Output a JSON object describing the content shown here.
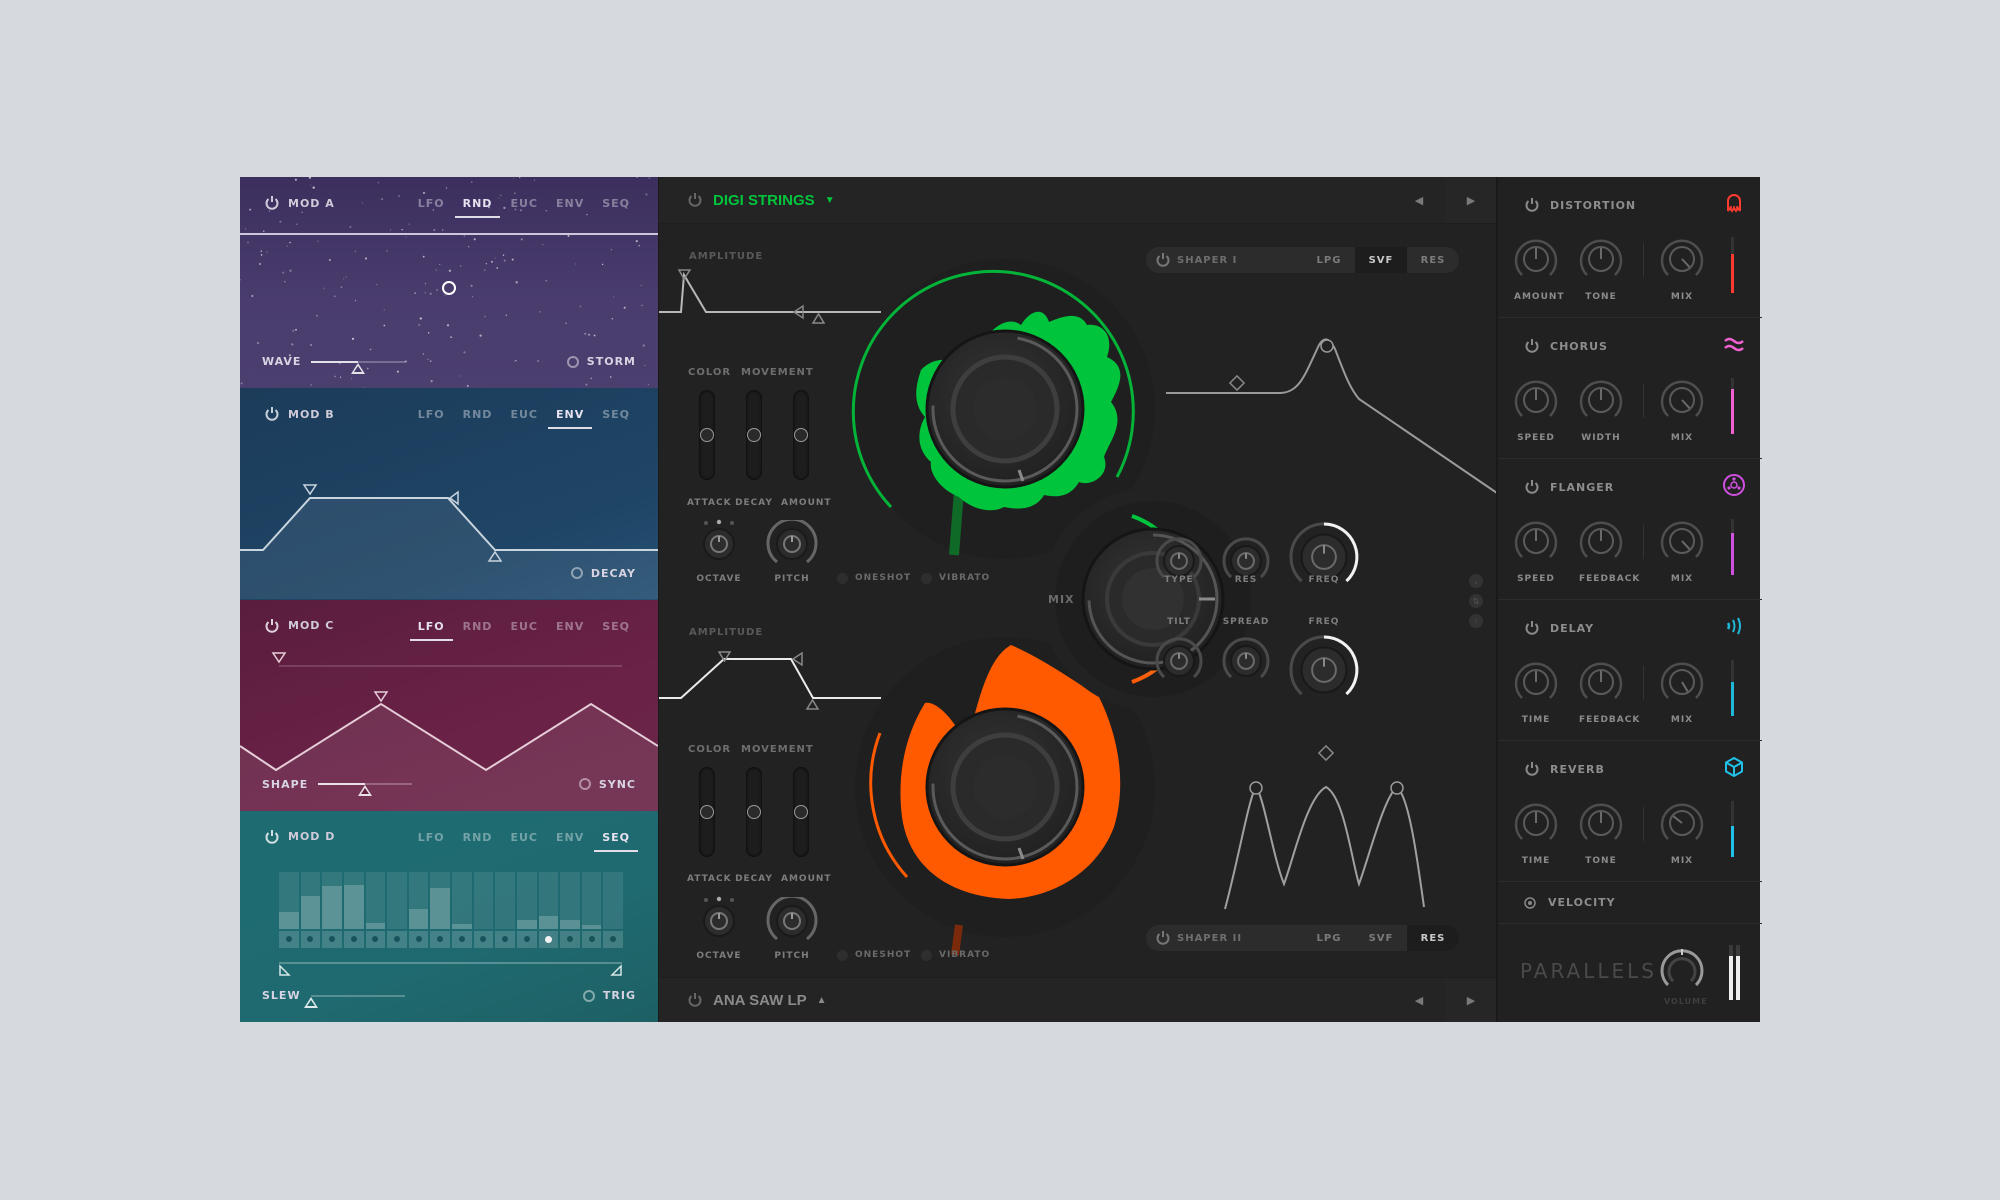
{
  "mod_tabs": [
    "LFO",
    "RND",
    "EUC",
    "ENV",
    "SEQ"
  ],
  "mods": [
    {
      "title": "MOD A",
      "active_tab": "RND",
      "left_control": {
        "label": "WAVE",
        "value": 0.5
      },
      "right_toggle": "STORM",
      "bg": "#463a69"
    },
    {
      "title": "MOD B",
      "active_tab": "ENV",
      "right_toggle": "DECAY",
      "bg": "#1f4566"
    },
    {
      "title": "MOD C",
      "active_tab": "LFO",
      "left_control": {
        "label": "SHAPE",
        "value": 0.5
      },
      "right_toggle": "SYNC",
      "bg": "#66213f"
    },
    {
      "title": "MOD D",
      "active_tab": "SEQ",
      "left_control": {
        "label": "SLEW",
        "value": 0.0
      },
      "right_toggle": "TRIG",
      "bg": "#1f686e",
      "sequence": {
        "steps": [
          0.3,
          0.58,
          0.75,
          0.77,
          0.1,
          0.0,
          0.35,
          0.71,
          0.08,
          0.0,
          0.0,
          0.15,
          0.23,
          0.16,
          0.07,
          0.0
        ],
        "active_step": 12
      }
    }
  ],
  "engines": {
    "top": {
      "preset": "DIGI STRINGS",
      "preset_arrow": "▼",
      "color": "#00c43c",
      "amp_label": "AMPLITUDE",
      "color_label": "COLOR",
      "movement_label": "MOVEMENT",
      "sliders": [
        {
          "label": "ATTACK",
          "value": 0.5
        },
        {
          "label": "DECAY",
          "value": 0.5
        },
        {
          "label": "AMOUNT",
          "value": 0.5
        }
      ],
      "octave_label": "OCTAVE",
      "pitch_label": "PITCH",
      "oneshot_label": "ONESHOT",
      "vibrato_label": "VIBRATO"
    },
    "bottom": {
      "preset": "ANA SAW LP",
      "preset_arrow": "▲",
      "color": "#ff5a00",
      "amp_label": "AMPLITUDE",
      "color_label": "COLOR",
      "movement_label": "MOVEMENT",
      "sliders": [
        {
          "label": "ATTACK",
          "value": 0.5
        },
        {
          "label": "DECAY",
          "value": 0.5
        },
        {
          "label": "AMOUNT",
          "value": 0.5
        }
      ],
      "octave_label": "OCTAVE",
      "pitch_label": "PITCH",
      "oneshot_label": "ONESHOT",
      "vibrato_label": "VIBRATO"
    }
  },
  "nav": {
    "prev": "◀",
    "next": "▶"
  },
  "mix": {
    "label": "MIX"
  },
  "shapers": [
    {
      "name": "SHAPER I",
      "options": [
        "LPG",
        "SVF",
        "RES"
      ],
      "active": "SVF",
      "knobs": [
        {
          "label": "TYPE"
        },
        {
          "label": "RES"
        },
        {
          "label": "FREQ"
        }
      ]
    },
    {
      "name": "SHAPER II",
      "options": [
        "LPG",
        "SVF",
        "RES"
      ],
      "active": "RES",
      "knobs": [
        {
          "label": "TILT"
        },
        {
          "label": "SPREAD"
        },
        {
          "label": "FREQ"
        }
      ]
    }
  ],
  "routing_icons": [
    "arrow-down-icon",
    "arrow-both-icon",
    "arrow-up-icon"
  ],
  "fx": [
    {
      "title": "DISTORTION",
      "icon": "ghost-icon",
      "color": "#ff3b30",
      "knobs": [
        "AMOUNT",
        "TONE",
        "MIX"
      ],
      "level": 0.7
    },
    {
      "title": "CHORUS",
      "icon": "waves-icon",
      "color": "#f060d0",
      "knobs": [
        "SPEED",
        "WIDTH",
        "MIX"
      ],
      "level": 0.8
    },
    {
      "title": "FLANGER",
      "icon": "orbit-icon",
      "color": "#d050e0",
      "knobs": [
        "SPEED",
        "FEEDBACK",
        "MIX"
      ],
      "level": 0.75
    },
    {
      "title": "DELAY",
      "icon": "signal-icon",
      "color": "#20b8d8",
      "knobs": [
        "TIME",
        "FEEDBACK",
        "MIX"
      ],
      "level": 0.6
    },
    {
      "title": "REVERB",
      "icon": "cube-icon",
      "color": "#20c0e8",
      "knobs": [
        "TIME",
        "TONE",
        "MIX"
      ],
      "level": 0.55
    }
  ],
  "velocity": {
    "label": "VELOCITY"
  },
  "brand": "PARALLELS",
  "volume": {
    "label": "VOLUME",
    "value": 0.5,
    "meters": [
      0.8,
      0.8
    ]
  }
}
